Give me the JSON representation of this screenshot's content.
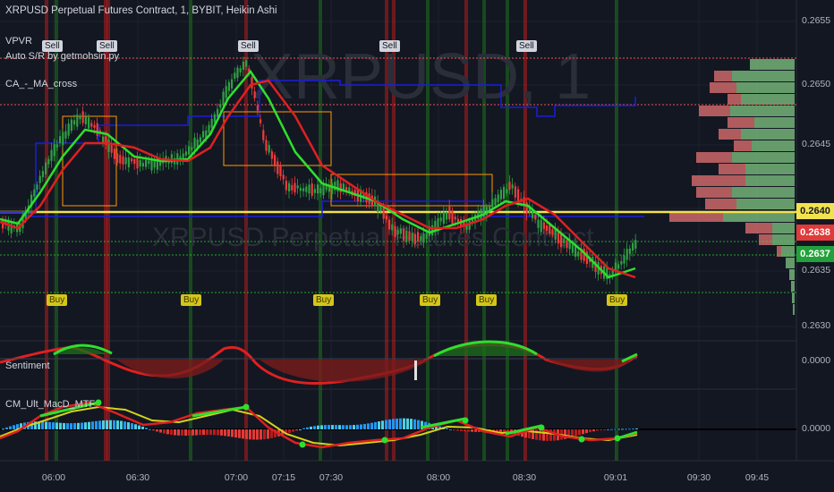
{
  "header": {
    "title": "XRPUSD Perpetual Futures Contract, 1, BYBIT, Heikin Ashi",
    "indicators": [
      "VPVR",
      "Auto S/R by getmohsin.py",
      "CA_-_MA_cross"
    ],
    "watermark": "XRPUSD, 1",
    "watermark2": "XRPUSD Perpetual Futures Contract"
  },
  "price_axis": {
    "ticks": [
      "0.2655",
      "0.2650",
      "0.2645",
      "0.2640",
      "0.2635",
      "0.2630"
    ],
    "badges": [
      {
        "label": "0.2640",
        "bg": "#f2e24d",
        "fg": "#131722"
      },
      {
        "label": "0.2638",
        "bg": "#e03a3a",
        "fg": "#ffffff"
      },
      {
        "label": "0.2637",
        "bg": "#22a13a",
        "fg": "#ffffff"
      }
    ]
  },
  "signals": {
    "sell": [
      "Sell",
      "Sell",
      "Sell",
      "Sell",
      "Sell"
    ],
    "buy": [
      "Buy",
      "Buy",
      "Buy",
      "Buy",
      "Buy",
      "Buy"
    ]
  },
  "sentiment_pane": {
    "title": "Sentiment",
    "zero_label": "0.0000"
  },
  "macd_pane": {
    "title": "CM_Ult_MacD_MTF",
    "zero_label": "0.0000"
  },
  "time_axis": {
    "labels": [
      "06:00",
      "06:30",
      "07:00",
      "07:15",
      "07:30",
      "08:00",
      "08:30",
      "09:01",
      "09:30",
      "09:45"
    ]
  },
  "colors": {
    "background": "#131722",
    "up": "#26a69a",
    "down": "#ef3b3b",
    "ma_green": "#2ee02e",
    "ma_red": "#e02020",
    "buy_tag": "#d4c51a",
    "support": "#f2e24d"
  }
}
